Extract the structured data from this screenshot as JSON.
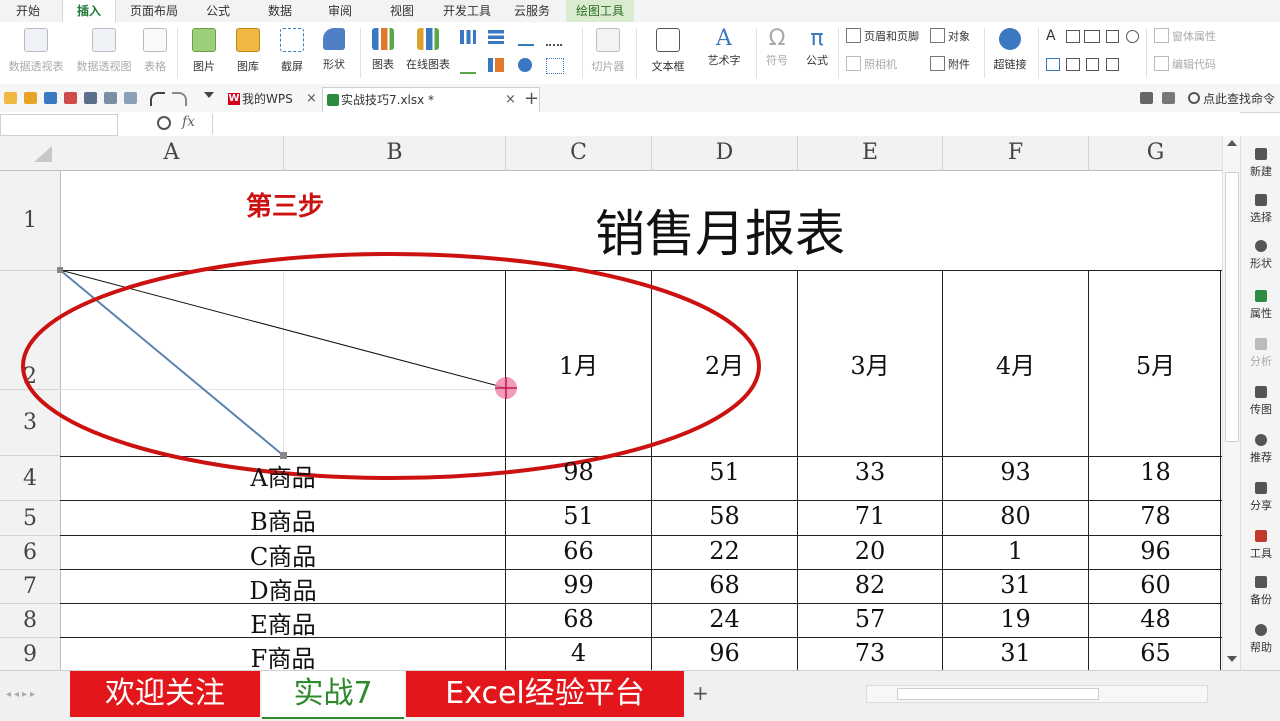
{
  "ribbon_tabs": [
    "开始",
    "插入",
    "页面布局",
    "公式",
    "数据",
    "审阅",
    "视图",
    "开发工具",
    "云服务",
    "绘图工具"
  ],
  "ribbon": {
    "pivot_table": "数据透视表",
    "pivot_chart": "数据透视图",
    "table": "表格",
    "picture": "图片",
    "gallery": "图库",
    "screenshot": "截屏",
    "shape": "形状",
    "chart": "图表",
    "online_chart": "在线图表",
    "slicer": "切片器",
    "textbox": "文本框",
    "wordart": "艺术字",
    "symbol": "符号",
    "formula": "公式",
    "header_footer": "页眉和页脚",
    "object": "对象",
    "camera": "照相机",
    "attachment": "附件",
    "hyperlink": "超链接",
    "form_props": "窗体属性",
    "edit_code": "编辑代码",
    "formula_letter": "A",
    "pi": "π",
    "omega": "Ω"
  },
  "doc_tabs": {
    "home_tab": "我的WPS",
    "file_tab": "实战技巧7.xlsx *",
    "close": "×",
    "add": "+",
    "search": "点此查找命令"
  },
  "formula_bar": {
    "fx": "fx",
    "zoom_icon": "magnifier"
  },
  "sheet": {
    "columns": [
      "A",
      "B",
      "C",
      "D",
      "E",
      "F",
      "G"
    ],
    "rows": [
      "1",
      "2",
      "3",
      "4",
      "5",
      "6",
      "7",
      "8",
      "9"
    ],
    "title": "销售月报表",
    "annotation": "第三步",
    "months": [
      "1月",
      "2月",
      "3月",
      "4月",
      "5月"
    ],
    "products": [
      "A商品",
      "B商品",
      "C商品",
      "D商品",
      "E商品",
      "F商品"
    ],
    "values": [
      [
        "98",
        "51",
        "33",
        "93",
        "18"
      ],
      [
        "51",
        "58",
        "71",
        "80",
        "78"
      ],
      [
        "66",
        "22",
        "20",
        "1",
        "96"
      ],
      [
        "99",
        "68",
        "82",
        "31",
        "60"
      ],
      [
        "68",
        "24",
        "57",
        "19",
        "48"
      ],
      [
        "4",
        "96",
        "73",
        "31",
        "65"
      ]
    ]
  },
  "right_panel": [
    "新建",
    "选择",
    "形状",
    "属性",
    "分析",
    "传图",
    "推荐",
    "分享",
    "工具",
    "备份",
    "帮助"
  ],
  "sheet_tabs": {
    "tab1": "欢迎关注",
    "tab2": "实战7",
    "tab3": "Excel经验平台",
    "add": "+"
  },
  "colors": {
    "accent_green": "#1e7a34",
    "annotation_red": "#cc1111",
    "tab_red": "#e3161b",
    "drawing_tools_bg": "#d9ecd0"
  }
}
